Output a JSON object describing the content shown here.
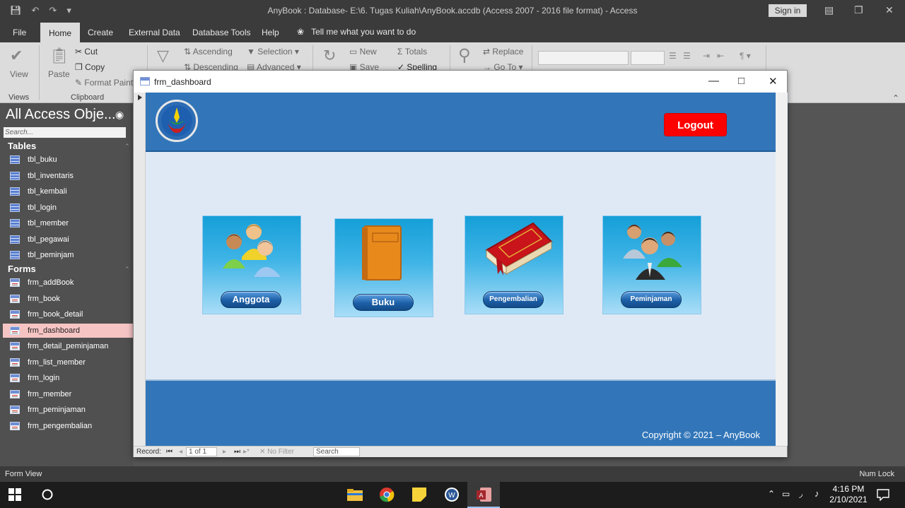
{
  "window": {
    "title": "AnyBook : Database- E:\\6. Tugas Kuliah\\AnyBook.accdb (Access 2007 - 2016 file format)  -  Access",
    "sign_in": "Sign in"
  },
  "ribbon_tabs": [
    "File",
    "Home",
    "Create",
    "External Data",
    "Database Tools",
    "Help"
  ],
  "tell_me": "Tell me what you want to do",
  "ribbon": {
    "view": "View",
    "paste": "Paste",
    "cut": "Cut",
    "copy": "Copy",
    "format_painter": "Format Paint",
    "ascending": "Ascending",
    "descending": "Descending",
    "selection": "Selection",
    "advanced": "Advanced",
    "new": "New",
    "save": "Save",
    "totals": "Totals",
    "spelling": "Spelling",
    "replace": "Replace",
    "go_to": "Go To",
    "group_views": "Views",
    "group_clipboard": "Clipboard"
  },
  "nav": {
    "title": "All Access Obje...",
    "search_placeholder": "Search...",
    "tables_label": "Tables",
    "forms_label": "Forms",
    "tables": [
      "tbl_buku",
      "tbl_inventaris",
      "tbl_kembali",
      "tbl_login",
      "tbl_member",
      "tbl_pegawai",
      "tbl_peminjam"
    ],
    "forms": [
      "frm_addBook",
      "frm_book",
      "frm_book_detail",
      "frm_dashboard",
      "frm_detail_peminjaman",
      "frm_list_member",
      "frm_login",
      "frm_member",
      "frm_peminjaman",
      "frm_pengembalian"
    ],
    "selected_form": "frm_dashboard"
  },
  "form": {
    "title": "frm_dashboard",
    "logout": "Logout",
    "tiles": [
      "Anggota",
      "Buku",
      "Pengembalian",
      "Peminjaman"
    ],
    "copyright": "Copyright © 2021 – AnyBook"
  },
  "record_bar": {
    "label": "Record:",
    "position": "1 of 1",
    "filter": "No Filter",
    "search": "Search"
  },
  "status": {
    "left": "Form View",
    "right": "Num Lock"
  },
  "taskbar": {
    "time": "4:16 PM",
    "date": "2/10/2021"
  },
  "colors": {
    "header_blue": "#3276b9",
    "logout_red": "#ff0000",
    "form_bg": "#dfe9f5",
    "nav_selected": "#f7c4c4"
  }
}
